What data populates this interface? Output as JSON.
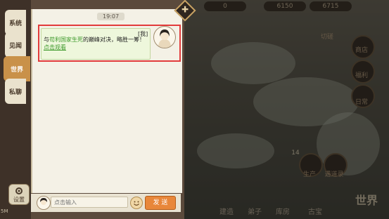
{
  "chat": {
    "tabs": [
      {
        "label": "系统"
      },
      {
        "label": "见闻"
      },
      {
        "label": "世界"
      },
      {
        "label": "私聊"
      }
    ],
    "active_tab": "世界",
    "settings_label": "设置",
    "corner_text": "5M",
    "time": "19:07",
    "message": {
      "tag": "[我]",
      "prefix": "与",
      "highlight": "苟利国家生死",
      "suffix": "的巅峰对决，略胜一筹！",
      "link": "点击观看"
    },
    "input": {
      "placeholder": "点击输入",
      "send_label": "发 送"
    },
    "collapse_icon": "✚"
  },
  "game": {
    "resources": [
      "0",
      "6150",
      "6715"
    ],
    "side_buttons": [
      "商店",
      "福利",
      "日常"
    ],
    "side_top": "切磋",
    "produce": "生产",
    "recruit": "遇道录",
    "produce_count": "14",
    "bottom_menu": [
      "建造",
      "弟子",
      "库房",
      "古宝"
    ],
    "world_label": "世界"
  },
  "colors": {
    "accent_tab": "#c99149",
    "send_button": "#e8873a",
    "highlight_border": "#e23b3b",
    "bubble": "#eef7dc",
    "link_green": "#3d9a2b"
  }
}
